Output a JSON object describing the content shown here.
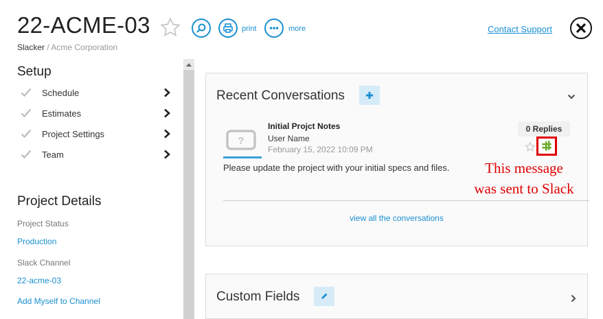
{
  "header": {
    "title": "22-ACME-03",
    "print_label": "print",
    "more_label": "more",
    "contact_support": "Contact Support"
  },
  "breadcrumb": {
    "user": "Slacker",
    "separator": "/",
    "org": "Acme Corporation"
  },
  "setup": {
    "heading": "Setup",
    "items": [
      {
        "label": "Schedule"
      },
      {
        "label": "Estimates"
      },
      {
        "label": "Project Settings"
      },
      {
        "label": "Team"
      }
    ]
  },
  "project_details": {
    "heading": "Project Details",
    "status_label": "Project Status",
    "status_value": "Production",
    "slack_label": "Slack Channel",
    "slack_value": "22-acme-03",
    "add_myself": "Add Myself to Channel"
  },
  "recent": {
    "heading": "Recent Conversations",
    "message": {
      "title": "Initial Projct Notes",
      "user": "User Name",
      "date": "February 15, 2022 10:09 PM",
      "replies": "0 Replies",
      "body": "Please update the project with your initial specs and files."
    },
    "view_all": "view all the conversations"
  },
  "annotation": {
    "line1": "This message",
    "line2": "was sent to Slack"
  },
  "custom_fields": {
    "heading": "Custom Fields"
  },
  "colors": {
    "accent": "#1a8fd1",
    "annotation": "#e00000"
  }
}
